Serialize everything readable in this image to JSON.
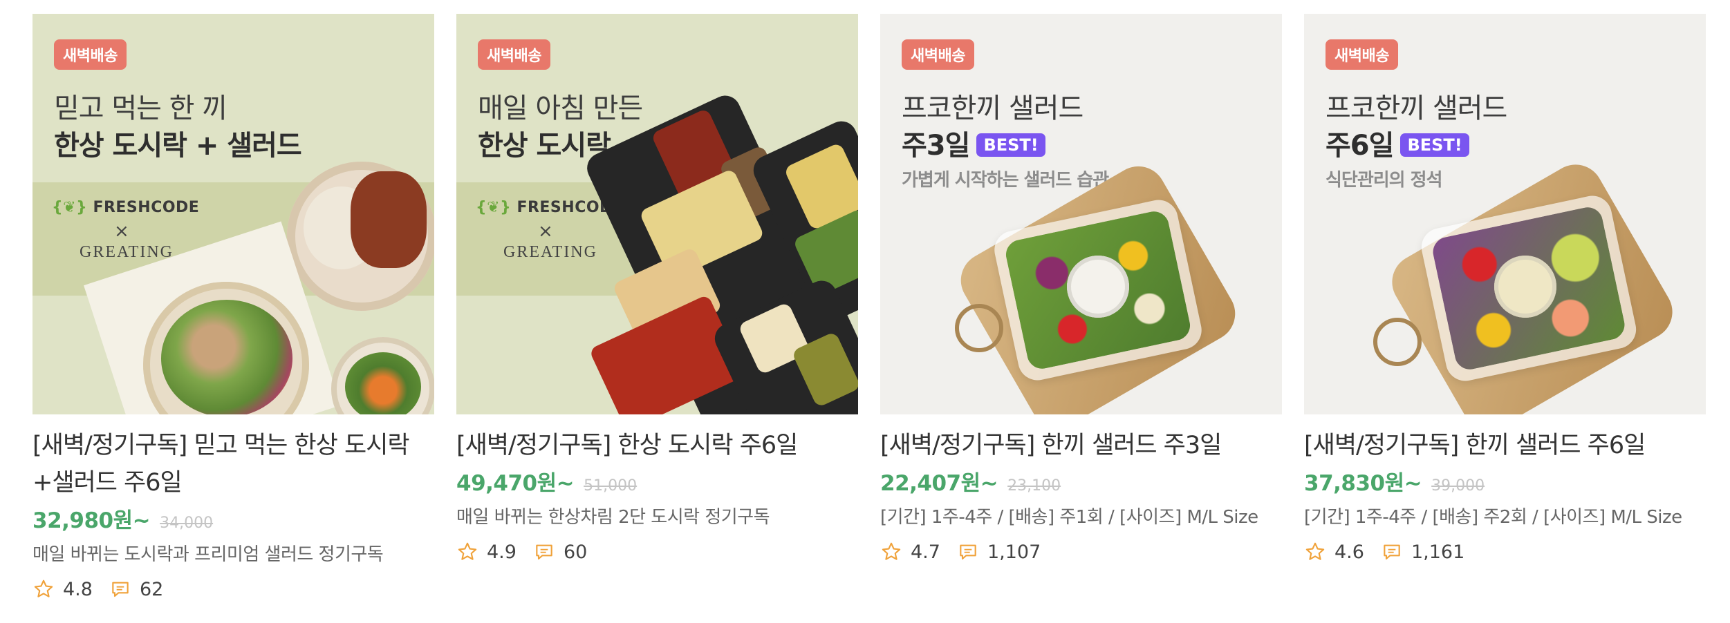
{
  "products": [
    {
      "badge": "새벽배송",
      "headline_line1": "믿고 먹는 한 끼",
      "headline_line2": "한상 도시락 + 샐러드",
      "brand": "FRESHCODE",
      "collab_mark": "×",
      "collab_partner": "GREATING",
      "title": "[새벽/정기구독] 믿고 먹는 한상 도시락+샐러드 주6일",
      "price": "32,980원~",
      "original_price": "34,000",
      "description": "매일 바뀌는 도시락과 프리미엄 샐러드 정기구독",
      "rating": "4.8",
      "reviews": "62"
    },
    {
      "badge": "새벽배송",
      "headline_line1": "매일 아침 만든",
      "headline_line2": "한상 도시락",
      "brand": "FRESHCODE",
      "collab_mark": "×",
      "collab_partner": "GREATING",
      "title": "[새벽/정기구독] 한상 도시락 주6일",
      "price": "49,470원~",
      "original_price": "51,000",
      "description": "매일 바뀌는 한상차림 2단 도시락 정기구독",
      "rating": "4.9",
      "reviews": "60"
    },
    {
      "badge": "새벽배송",
      "headline_line1": "프코한끼 샐러드",
      "headline_line2": "주3일",
      "best": "BEST!",
      "subheadline": "가볍게 시작하는 샐러드 습관",
      "title": "[새벽/정기구독] 한끼 샐러드 주3일",
      "price": "22,407원~",
      "original_price": "23,100",
      "description": "[기간] 1주-4주 / [배송] 주1회 / [사이즈] M/L Size",
      "rating": "4.7",
      "reviews": "1,107"
    },
    {
      "badge": "새벽배송",
      "headline_line1": "프코한끼 샐러드",
      "headline_line2": "주6일",
      "best": "BEST!",
      "subheadline": "식단관리의 정석",
      "title": "[새벽/정기구독] 한끼 샐러드 주6일",
      "price": "37,830원~",
      "original_price": "39,000",
      "description": "[기간] 1주-4주 / [배송] 주2회 / [사이즈] M/L Size",
      "rating": "4.6",
      "reviews": "1,161"
    }
  ],
  "colors": {
    "price_green": "#4aa66a",
    "badge_red": "#e8786a",
    "best_purple": "#7a55f0",
    "star_orange": "#f0a23a"
  },
  "icons": {
    "rating": "star-outline-icon",
    "reviews": "speech-bubble-icon"
  }
}
